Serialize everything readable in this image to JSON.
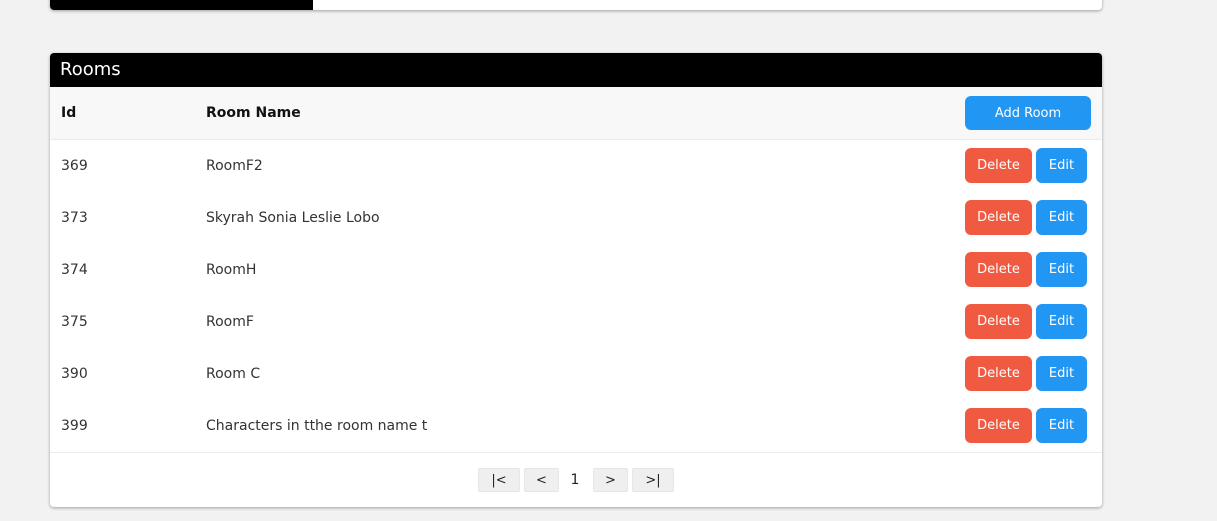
{
  "panel": {
    "title": "Rooms"
  },
  "table": {
    "headers": {
      "id": "Id",
      "name": "Room Name"
    },
    "add_label": "Add Room",
    "delete_label": "Delete",
    "edit_label": "Edit",
    "rows": [
      {
        "id": "369",
        "name": "RoomF2"
      },
      {
        "id": "373",
        "name": "Skyrah Sonia Leslie Lobo"
      },
      {
        "id": "374",
        "name": "RoomH"
      },
      {
        "id": "375",
        "name": "RoomF"
      },
      {
        "id": "390",
        "name": "Room C"
      },
      {
        "id": "399",
        "name": "Characters in tthe room name t"
      }
    ]
  },
  "pager": {
    "first_label": "|<",
    "prev_label": "<",
    "page": "1",
    "next_label": ">",
    "last_label": ">|"
  },
  "colors": {
    "header_bg": "#000000",
    "primary": "#2196f3",
    "danger": "#f05a40"
  }
}
